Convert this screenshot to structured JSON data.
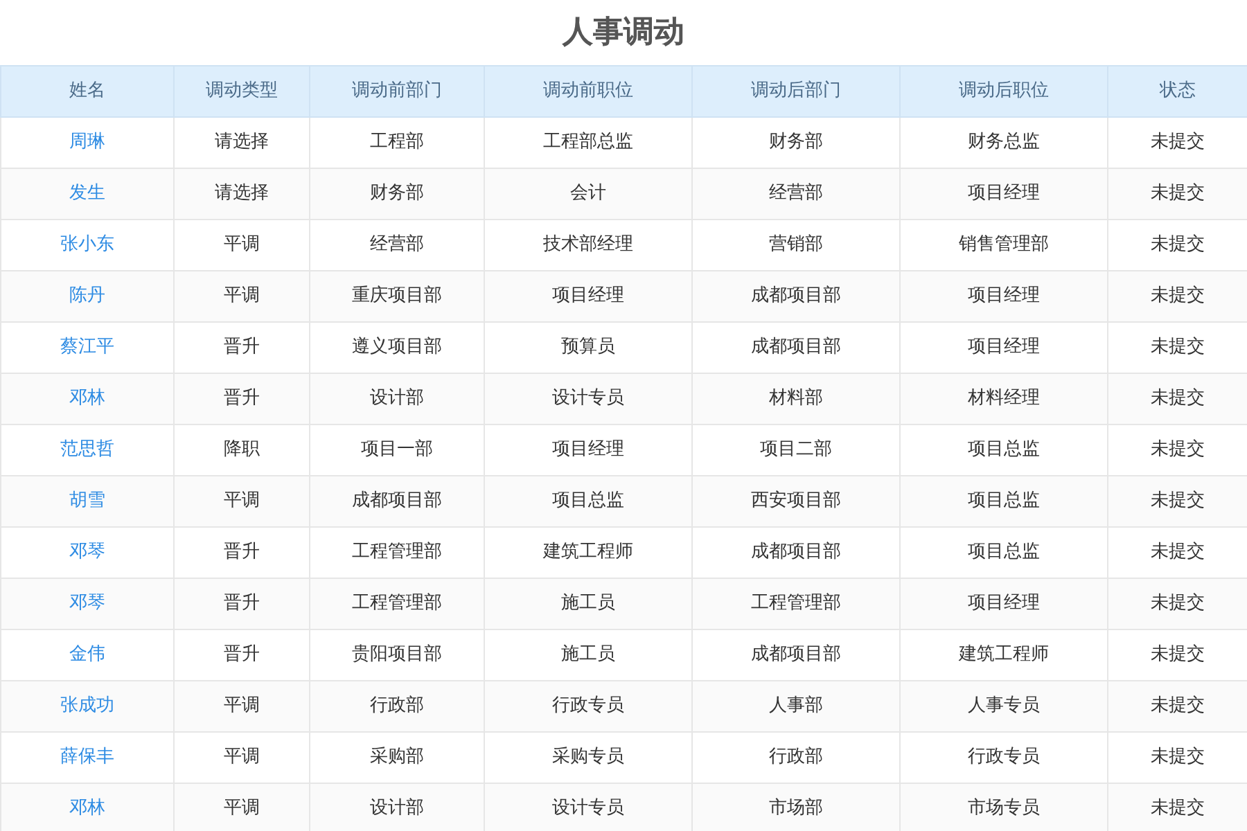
{
  "title": "人事调动",
  "table": {
    "columns": [
      "姓名",
      "调动类型",
      "调动前部门",
      "调动前职位",
      "调动后部门",
      "调动后职位",
      "状态"
    ],
    "rows": [
      [
        "周琳",
        "请选择",
        "工程部",
        "工程部总监",
        "财务部",
        "财务总监",
        "未提交"
      ],
      [
        "发生",
        "请选择",
        "财务部",
        "会计",
        "经营部",
        "项目经理",
        "未提交"
      ],
      [
        "张小东",
        "平调",
        "经营部",
        "技术部经理",
        "营销部",
        "销售管理部",
        "未提交"
      ],
      [
        "陈丹",
        "平调",
        "重庆项目部",
        "项目经理",
        "成都项目部",
        "项目经理",
        "未提交"
      ],
      [
        "蔡江平",
        "晋升",
        "遵义项目部",
        "预算员",
        "成都项目部",
        "项目经理",
        "未提交"
      ],
      [
        "邓林",
        "晋升",
        "设计部",
        "设计专员",
        "材料部",
        "材料经理",
        "未提交"
      ],
      [
        "范思哲",
        "降职",
        "项目一部",
        "项目经理",
        "项目二部",
        "项目总监",
        "未提交"
      ],
      [
        "胡雪",
        "平调",
        "成都项目部",
        "项目总监",
        "西安项目部",
        "项目总监",
        "未提交"
      ],
      [
        "邓琴",
        "晋升",
        "工程管理部",
        "建筑工程师",
        "成都项目部",
        "项目总监",
        "未提交"
      ],
      [
        "邓琴",
        "晋升",
        "工程管理部",
        "施工员",
        "工程管理部",
        "项目经理",
        "未提交"
      ],
      [
        "金伟",
        "晋升",
        "贵阳项目部",
        "施工员",
        "成都项目部",
        "建筑工程师",
        "未提交"
      ],
      [
        "张成功",
        "平调",
        "行政部",
        "行政专员",
        "人事部",
        "人事专员",
        "未提交"
      ],
      [
        "薛保丰",
        "平调",
        "采购部",
        "采购专员",
        "行政部",
        "行政专员",
        "未提交"
      ],
      [
        "邓林",
        "平调",
        "设计部",
        "设计专员",
        "市场部",
        "市场专员",
        "未提交"
      ]
    ]
  }
}
